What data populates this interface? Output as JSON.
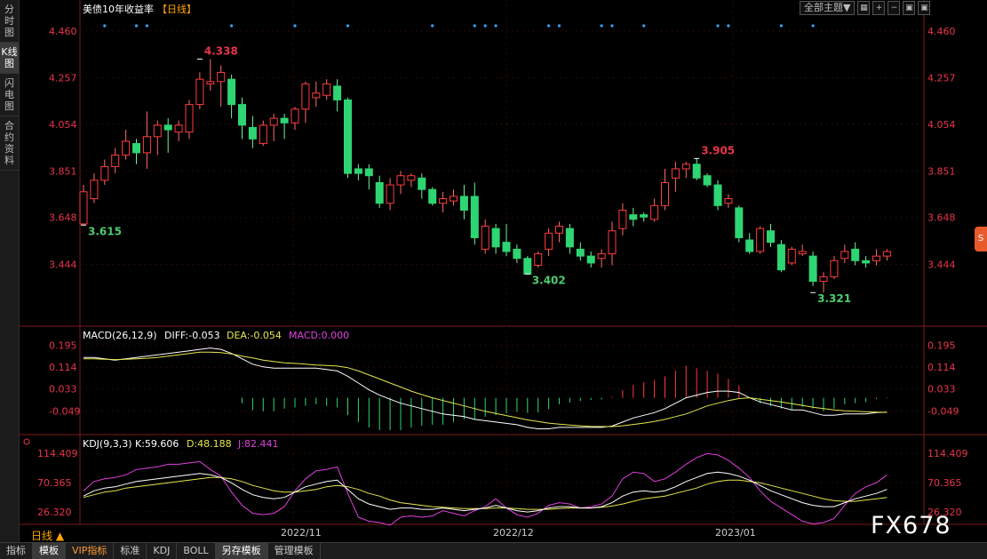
{
  "left_tabs": [
    "分时图",
    "K线图",
    "闪电图",
    "合约资料"
  ],
  "title": "美债10年收益率",
  "period_tag": "【日线】",
  "toolbar": {
    "theme": "全部主题▼",
    "icons": [
      "grid-icon",
      "plus-icon",
      "minus-icon",
      "box-icon",
      "box-icon"
    ]
  },
  "colors": {
    "up": "#ff3b3b",
    "down": "#2ed573",
    "diff": "#ffffff",
    "dea": "#e6e64c",
    "macd_label": "#e040e0",
    "k": "#ffffff",
    "d": "#e6e64c",
    "j": "#e040e0",
    "label_red": "#e8354a",
    "label_green": "#4ccc6f"
  },
  "main_axis_ticks": [
    "4.460",
    "4.257",
    "4.054",
    "3.851",
    "3.648",
    "3.444"
  ],
  "macd_label": {
    "name": "MACD(26,12,9)",
    "diff": "DIFF:-0.053",
    "dea": "DEA:-0.054",
    "macd": "MACD:0.000"
  },
  "macd_ticks": [
    "0.195",
    "0.114",
    "0.033",
    "-0.049"
  ],
  "kdj_label": {
    "name": "KDJ(9,3,3)",
    "k": "K:59.606",
    "d": "D:48.188",
    "j": "J:82.441"
  },
  "kdj_ticks": [
    "114.409",
    "70.365",
    "26.320"
  ],
  "date_labels": [
    "2022/11",
    "2022/12",
    "2023/01"
  ],
  "period_label": "日线 ▲",
  "bottom_tabs": [
    "指标",
    "模板",
    "VIP指标",
    "标准",
    "KDJ",
    "BOLL",
    "另存模板",
    "管理模板"
  ],
  "watermark": "FX678",
  "chart_data": {
    "type": "candlestick",
    "title": "美债10年收益率",
    "ylim": [
      3.26,
      4.51
    ],
    "annotations": [
      {
        "text": "4.338",
        "i": 11,
        "value": 4.338,
        "pos": "above"
      },
      {
        "text": "3.615",
        "i": 0,
        "value": 3.615,
        "pos": "below"
      },
      {
        "text": "3.402",
        "i": 42,
        "value": 3.402,
        "pos": "below"
      },
      {
        "text": "3.905",
        "i": 58,
        "value": 3.905,
        "pos": "above"
      },
      {
        "text": "3.321",
        "i": 69,
        "value": 3.321,
        "pos": "below"
      }
    ],
    "event_markers": [
      2,
      5,
      6,
      14,
      20,
      25,
      33,
      37,
      38,
      39,
      44,
      45,
      49,
      50,
      53,
      60,
      61,
      66,
      69
    ],
    "candles": [
      [
        3.62,
        3.76,
        3.615,
        3.79
      ],
      [
        3.73,
        3.81,
        3.71,
        3.84
      ],
      [
        3.81,
        3.87,
        3.79,
        3.9
      ],
      [
        3.87,
        3.92,
        3.84,
        3.95
      ],
      [
        3.92,
        3.98,
        3.9,
        4.03
      ],
      [
        3.97,
        3.93,
        3.88,
        3.99
      ],
      [
        3.93,
        4.0,
        3.86,
        4.11
      ],
      [
        4.0,
        4.05,
        3.92,
        4.07
      ],
      [
        4.05,
        4.03,
        3.93,
        4.08
      ],
      [
        4.02,
        4.05,
        3.98,
        4.07
      ],
      [
        4.02,
        4.14,
        3.99,
        4.16
      ],
      [
        4.14,
        4.25,
        4.12,
        4.28
      ],
      [
        4.23,
        4.24,
        4.2,
        4.338
      ],
      [
        4.24,
        4.28,
        4.13,
        4.31
      ],
      [
        4.25,
        4.14,
        4.08,
        4.27
      ],
      [
        4.14,
        4.05,
        3.99,
        4.17
      ],
      [
        4.04,
        3.99,
        3.95,
        4.09
      ],
      [
        3.97,
        4.05,
        3.96,
        4.07
      ],
      [
        4.05,
        4.08,
        3.98,
        4.1
      ],
      [
        4.08,
        4.06,
        3.99,
        4.1
      ],
      [
        4.06,
        4.12,
        4.03,
        4.13
      ],
      [
        4.12,
        4.23,
        4.06,
        4.24
      ],
      [
        4.17,
        4.19,
        4.13,
        4.24
      ],
      [
        4.18,
        4.23,
        4.16,
        4.25
      ],
      [
        4.22,
        4.16,
        4.11,
        4.25
      ],
      [
        4.16,
        3.84,
        3.82,
        4.17
      ],
      [
        3.86,
        3.84,
        3.81,
        3.88
      ],
      [
        3.86,
        3.83,
        3.77,
        3.88
      ],
      [
        3.8,
        3.71,
        3.69,
        3.83
      ],
      [
        3.71,
        3.79,
        3.68,
        3.82
      ],
      [
        3.79,
        3.83,
        3.75,
        3.85
      ],
      [
        3.81,
        3.83,
        3.78,
        3.84
      ],
      [
        3.82,
        3.77,
        3.73,
        3.84
      ],
      [
        3.77,
        3.71,
        3.7,
        3.78
      ],
      [
        3.71,
        3.73,
        3.67,
        3.76
      ],
      [
        3.72,
        3.74,
        3.7,
        3.77
      ],
      [
        3.74,
        3.68,
        3.64,
        3.79
      ],
      [
        3.74,
        3.56,
        3.53,
        3.8
      ],
      [
        3.51,
        3.61,
        3.49,
        3.64
      ],
      [
        3.6,
        3.52,
        3.49,
        3.62
      ],
      [
        3.54,
        3.5,
        3.48,
        3.62
      ],
      [
        3.51,
        3.47,
        3.45,
        3.53
      ],
      [
        3.47,
        3.402,
        3.4,
        3.48
      ],
      [
        3.44,
        3.49,
        3.43,
        3.5
      ],
      [
        3.51,
        3.58,
        3.48,
        3.6
      ],
      [
        3.58,
        3.61,
        3.54,
        3.63
      ],
      [
        3.6,
        3.52,
        3.49,
        3.62
      ],
      [
        3.51,
        3.48,
        3.46,
        3.54
      ],
      [
        3.48,
        3.45,
        3.43,
        3.5
      ],
      [
        3.47,
        3.49,
        3.43,
        3.51
      ],
      [
        3.49,
        3.59,
        3.44,
        3.63
      ],
      [
        3.6,
        3.68,
        3.57,
        3.71
      ],
      [
        3.66,
        3.64,
        3.61,
        3.69
      ],
      [
        3.66,
        3.65,
        3.63,
        3.67
      ],
      [
        3.64,
        3.7,
        3.63,
        3.73
      ],
      [
        3.7,
        3.8,
        3.68,
        3.86
      ],
      [
        3.82,
        3.86,
        3.76,
        3.89
      ],
      [
        3.86,
        3.88,
        3.82,
        3.89
      ],
      [
        3.88,
        3.82,
        3.81,
        3.905
      ],
      [
        3.83,
        3.79,
        3.78,
        3.84
      ],
      [
        3.79,
        3.7,
        3.68,
        3.81
      ],
      [
        3.71,
        3.73,
        3.69,
        3.75
      ],
      [
        3.69,
        3.56,
        3.54,
        3.7
      ],
      [
        3.55,
        3.5,
        3.49,
        3.58
      ],
      [
        3.5,
        3.6,
        3.49,
        3.61
      ],
      [
        3.59,
        3.54,
        3.52,
        3.62
      ],
      [
        3.53,
        3.42,
        3.41,
        3.55
      ],
      [
        3.45,
        3.51,
        3.44,
        3.52
      ],
      [
        3.49,
        3.5,
        3.48,
        3.53
      ],
      [
        3.48,
        3.37,
        3.35,
        3.5
      ],
      [
        3.37,
        3.39,
        3.321,
        3.41
      ],
      [
        3.39,
        3.46,
        3.38,
        3.48
      ],
      [
        3.47,
        3.5,
        3.45,
        3.53
      ],
      [
        3.51,
        3.46,
        3.44,
        3.54
      ],
      [
        3.46,
        3.45,
        3.43,
        3.48
      ],
      [
        3.46,
        3.48,
        3.44,
        3.51
      ],
      [
        3.48,
        3.5,
        3.46,
        3.51
      ]
    ],
    "macd": {
      "ylim": [
        -0.13,
        0.23
      ],
      "diff": [
        0.15,
        0.15,
        0.145,
        0.14,
        0.145,
        0.15,
        0.155,
        0.16,
        0.165,
        0.17,
        0.175,
        0.18,
        0.185,
        0.18,
        0.165,
        0.145,
        0.125,
        0.115,
        0.11,
        0.11,
        0.11,
        0.11,
        0.11,
        0.105,
        0.1,
        0.08,
        0.055,
        0.03,
        0.01,
        -0.005,
        -0.02,
        -0.03,
        -0.04,
        -0.05,
        -0.06,
        -0.065,
        -0.07,
        -0.08,
        -0.085,
        -0.09,
        -0.095,
        -0.1,
        -0.11,
        -0.115,
        -0.115,
        -0.11,
        -0.11,
        -0.11,
        -0.11,
        -0.11,
        -0.105,
        -0.09,
        -0.075,
        -0.065,
        -0.055,
        -0.04,
        -0.02,
        0,
        0.01,
        0.02,
        0.025,
        0.025,
        0.02,
        0.0,
        -0.015,
        -0.025,
        -0.035,
        -0.045,
        -0.045,
        -0.055,
        -0.065,
        -0.065,
        -0.06,
        -0.06,
        -0.06,
        -0.055,
        -0.053
      ],
      "dea": [
        0.145,
        0.145,
        0.143,
        0.142,
        0.143,
        0.145,
        0.147,
        0.15,
        0.155,
        0.16,
        0.165,
        0.17,
        0.17,
        0.168,
        0.163,
        0.155,
        0.148,
        0.14,
        0.135,
        0.13,
        0.128,
        0.125,
        0.122,
        0.12,
        0.118,
        0.112,
        0.1,
        0.085,
        0.07,
        0.055,
        0.04,
        0.025,
        0.012,
        0.0,
        -0.01,
        -0.02,
        -0.03,
        -0.04,
        -0.05,
        -0.058,
        -0.066,
        -0.074,
        -0.082,
        -0.088,
        -0.094,
        -0.098,
        -0.101,
        -0.104,
        -0.106,
        -0.107,
        -0.107,
        -0.104,
        -0.099,
        -0.094,
        -0.088,
        -0.08,
        -0.07,
        -0.06,
        -0.045,
        -0.03,
        -0.02,
        -0.01,
        -0.003,
        0,
        -0.005,
        -0.01,
        -0.015,
        -0.022,
        -0.028,
        -0.035,
        -0.04,
        -0.045,
        -0.048,
        -0.05,
        -0.052,
        -0.053,
        -0.054
      ],
      "hist_start": 15
    },
    "kdj": {
      "ylim": [
        10,
        128
      ],
      "k": [
        50,
        58,
        62,
        64,
        68,
        72,
        74,
        76,
        78,
        80,
        82,
        84,
        82,
        78,
        70,
        60,
        52,
        48,
        46,
        48,
        56,
        64,
        68,
        72,
        74,
        60,
        46,
        38,
        34,
        30,
        32,
        32,
        30,
        30,
        32,
        30,
        28,
        30,
        32,
        36,
        32,
        28,
        26,
        28,
        32,
        34,
        34,
        32,
        32,
        34,
        40,
        50,
        56,
        58,
        56,
        58,
        64,
        72,
        78,
        84,
        86,
        84,
        80,
        74,
        66,
        58,
        52,
        46,
        40,
        36,
        34,
        34,
        40,
        46,
        50,
        54,
        60
      ],
      "d": [
        48,
        52,
        56,
        58,
        62,
        64,
        66,
        68,
        70,
        72,
        74,
        76,
        78,
        78,
        76,
        72,
        66,
        62,
        58,
        56,
        56,
        58,
        60,
        64,
        66,
        64,
        60,
        54,
        50,
        44,
        40,
        38,
        36,
        34,
        33,
        32,
        31,
        31,
        31,
        32,
        32,
        31,
        30,
        30,
        30,
        31,
        32,
        32,
        32,
        33,
        35,
        38,
        42,
        46,
        48,
        50,
        54,
        58,
        62,
        68,
        72,
        74,
        74,
        72,
        70,
        66,
        62,
        58,
        54,
        50,
        46,
        43,
        42,
        42,
        44,
        46,
        48
      ],
      "j": [
        58,
        72,
        76,
        78,
        82,
        90,
        92,
        94,
        98,
        98,
        100,
        102,
        90,
        80,
        56,
        36,
        24,
        22,
        24,
        34,
        58,
        76,
        88,
        90,
        94,
        54,
        18,
        12,
        10,
        6,
        18,
        20,
        18,
        20,
        28,
        24,
        20,
        28,
        34,
        46,
        32,
        22,
        18,
        24,
        36,
        40,
        38,
        32,
        34,
        38,
        50,
        76,
        86,
        84,
        72,
        76,
        86,
        98,
        108,
        114,
        112,
        104,
        92,
        78,
        58,
        42,
        32,
        22,
        12,
        8,
        10,
        16,
        36,
        54,
        64,
        70,
        82
      ]
    }
  }
}
